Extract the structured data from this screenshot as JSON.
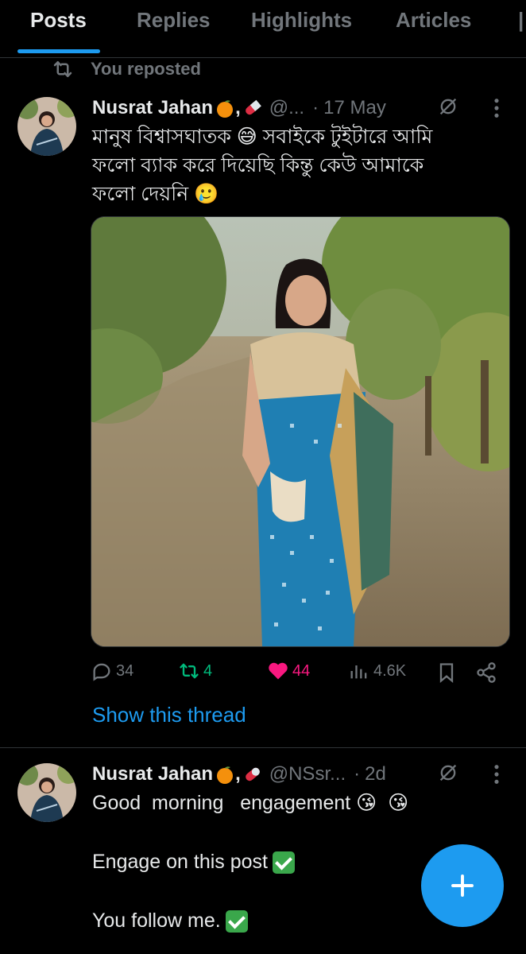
{
  "tabs": [
    {
      "label": "Posts",
      "active": true
    },
    {
      "label": "Replies"
    },
    {
      "label": "Highlights"
    },
    {
      "label": "Articles"
    }
  ],
  "repost": {
    "label": "You reposted"
  },
  "post1": {
    "author": "Nusrat Jahan",
    "author_suffix": ",",
    "handle": "@...",
    "time": "17 May",
    "text_line1": "মানুষ বিশ্বাসঘাতক 😅 সবাইকে টুইটারে আমি",
    "text_line2": "ফলো ব্যাক করে দিয়েছি কিন্তু কেউ আমাকে",
    "text_line3": "ফলো দেয়নি 🥲",
    "stats": {
      "replies": "34",
      "reposts": "4",
      "likes": "44",
      "views": "4.6K"
    },
    "show_thread": "Show this thread"
  },
  "post2": {
    "author": "Nusrat Jahan",
    "author_suffix": ",",
    "handle": "@NSsr...",
    "time": "2d",
    "text_line1": "Good  morning   engagement 😘  😘",
    "text_line2": "Engage on this post",
    "text_line3": "You follow me."
  },
  "colors": {
    "accent": "#1d9bf0",
    "repost_green": "#00ba7c",
    "like_pink": "#f91880",
    "muted": "#71767b"
  },
  "icons": [
    "repost-icon",
    "grok-icon",
    "more-icon",
    "reply-icon",
    "heart-icon",
    "views-icon",
    "bookmark-icon",
    "share-icon",
    "plus-icon"
  ]
}
